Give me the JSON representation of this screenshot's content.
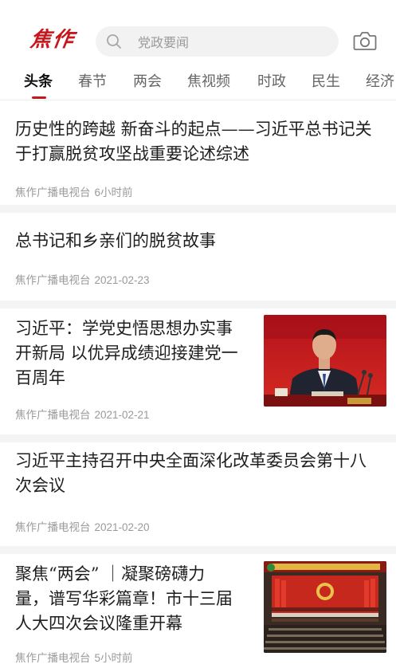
{
  "header": {
    "logo_text": "焦作",
    "search_placeholder": "党政要闻"
  },
  "tabs": [
    {
      "label": "头条",
      "active": true
    },
    {
      "label": "春节"
    },
    {
      "label": "两会"
    },
    {
      "label": "焦视频"
    },
    {
      "label": "时政"
    },
    {
      "label": "民生"
    },
    {
      "label": "经济"
    }
  ],
  "feed": [
    {
      "title_lines": [
        "历史性的跨越 新奋斗的起点——习近平总书记关",
        "于打赢脱贫攻坚战重要论述综述"
      ],
      "source": "焦作广播电视台",
      "time": "6小时前"
    },
    {
      "title_lines": [
        "总书记和乡亲们的脱贫故事"
      ],
      "source": "焦作广播电视台",
      "time": "2021-02-23"
    },
    {
      "title_lines": [
        "习近平：学党史悟思想办实事",
        "开新局 以优异成绩迎接建党一",
        "百周年"
      ],
      "source": "焦作广播电视台",
      "time": "2021-02-21",
      "thumbnail": "portrait-red-backdrop"
    },
    {
      "title_lines": [
        "习近平主持召开中央全面深化改革委员会第十八",
        "次会议"
      ],
      "source": "焦作广播电视台",
      "time": "2021-02-20"
    },
    {
      "title_lines": [
        "聚焦“两会” ｜凝聚磅礴力",
        "量，谱写华彩篇章！市十三届",
        "人大四次会议隆重开幕"
      ],
      "source": "焦作广播电视台",
      "time": "5小时前",
      "thumbnail": "assembly-hall"
    }
  ],
  "colors": {
    "brand_red": "#c8161d",
    "text_primary": "#1e1e1e",
    "text_meta": "#9a9a9a",
    "separator": "#f4f4f4"
  }
}
